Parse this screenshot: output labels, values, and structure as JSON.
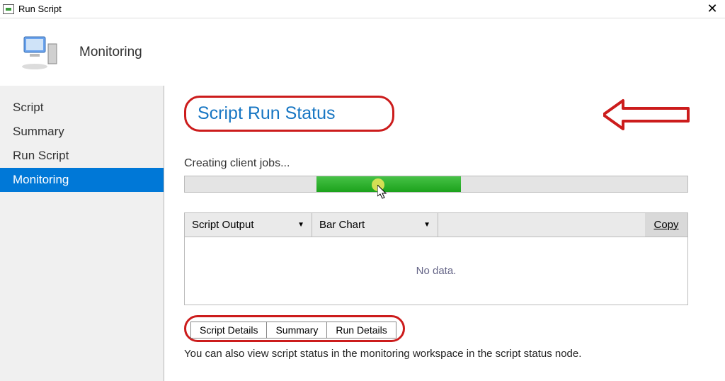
{
  "titlebar": {
    "title": "Run Script"
  },
  "header": {
    "title": "Monitoring"
  },
  "sidebar": {
    "items": [
      {
        "label": "Script"
      },
      {
        "label": "Summary"
      },
      {
        "label": "Run Script"
      },
      {
        "label": "Monitoring"
      }
    ],
    "selected_index": 3
  },
  "main": {
    "title": "Script Run Status",
    "progress_label": "Creating client jobs...",
    "dropdown1": "Script Output",
    "dropdown2": "Bar Chart",
    "copy_label": "Copy",
    "no_data": "No data.",
    "tabs": [
      {
        "label": "Script Details"
      },
      {
        "label": "Summary"
      },
      {
        "label": "Run Details"
      }
    ],
    "footer": "You can also view script status in the monitoring workspace in the script status node."
  },
  "colors": {
    "highlight": "#cc1c1c",
    "link": "#1776c3",
    "selection": "#0078d7",
    "progress": "#1ca21c"
  }
}
